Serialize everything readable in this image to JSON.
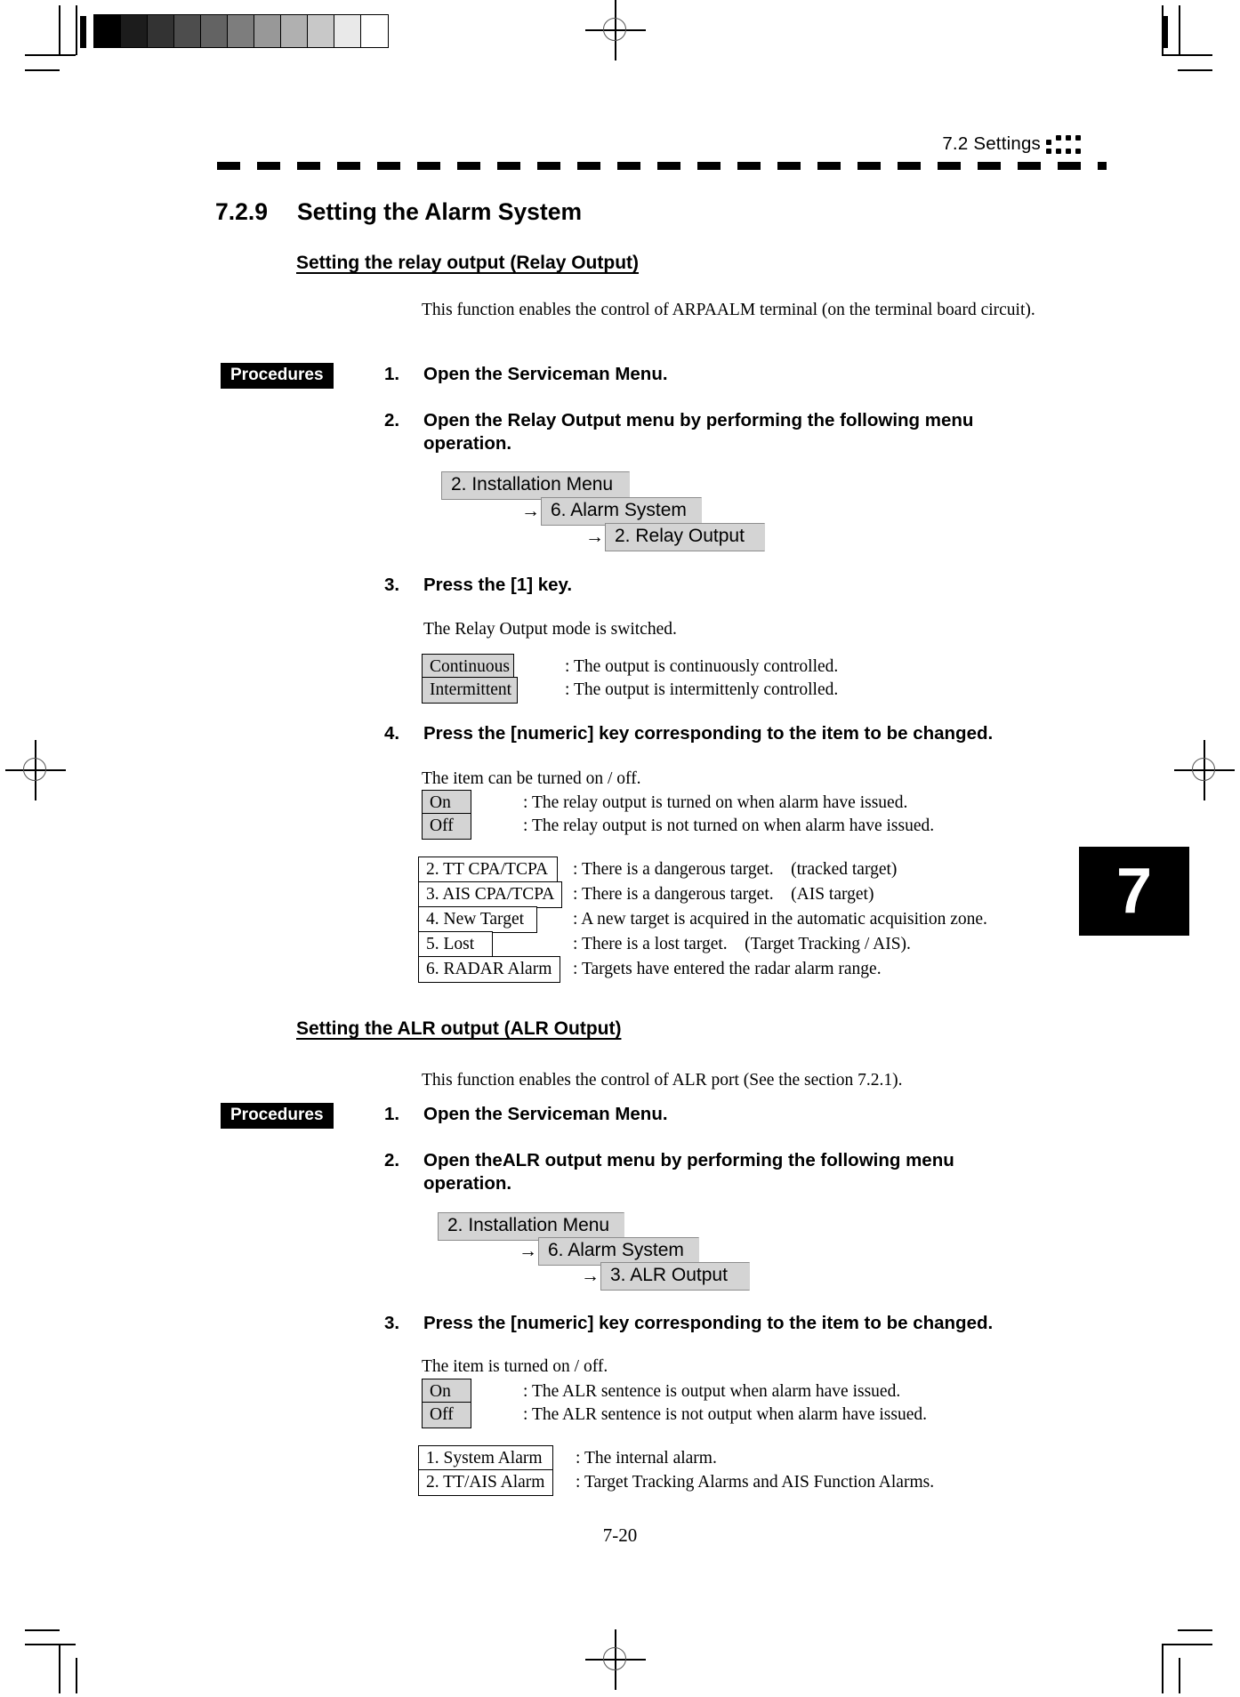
{
  "header": {
    "running_head": "7.2    Settings",
    "chapter_tab": "7",
    "page_number": "7-20"
  },
  "section": {
    "number": "7.2.9",
    "title": "Setting the Alarm System"
  },
  "relay": {
    "heading": "Setting the relay output (Relay Output)",
    "intro": "This function enables the control of ARPAALM terminal (on the terminal board circuit).",
    "procedures_badge": "Procedures",
    "steps": [
      {
        "n": "1.",
        "text": "Open the Serviceman Menu."
      },
      {
        "n": "2.",
        "text": "Open the Relay Output menu by performing the following menu operation."
      },
      {
        "n": "3.",
        "text": "Press the [1] key."
      },
      {
        "n": "4.",
        "text": "Press the [numeric] key corresponding to the item to be changed."
      }
    ],
    "menu_path": [
      {
        "arrow": "",
        "label": "2. Installation Menu"
      },
      {
        "arrow": "→",
        "label": "6. Alarm System"
      },
      {
        "arrow": "→",
        "label": "2. Relay Output"
      }
    ],
    "mode_note": "The Relay Output mode is switched.",
    "modes": [
      {
        "label": "Continuous",
        "desc": ": The output is continuously controlled."
      },
      {
        "label": "Intermittent",
        "desc": ": The output is intermittenly controlled."
      }
    ],
    "onoff_note": "The item can be turned on / off.",
    "onoff": [
      {
        "label": "On",
        "desc": ": The relay output is turned on when alarm have issued."
      },
      {
        "label": "Off",
        "desc": ": The relay output is not turned on when alarm have issued."
      }
    ],
    "items": [
      {
        "label": "2. TT CPA/TCPA",
        "desc": ": There is a dangerous target.    (tracked target)"
      },
      {
        "label": "3. AIS CPA/TCPA",
        "desc": ": There is a dangerous target.    (AIS target)"
      },
      {
        "label": "4. New Target",
        "desc": ": A new target is acquired in the automatic acquisition zone."
      },
      {
        "label": "5. Lost",
        "desc": ": There is a lost target.    (Target Tracking / AIS)."
      },
      {
        "label": "6. RADAR Alarm",
        "desc": ": Targets have entered the radar alarm range."
      }
    ]
  },
  "alr": {
    "heading": "Setting the ALR output (ALR Output)",
    "intro": "This function enables the control of ALR port (See the section 7.2.1).",
    "procedures_badge": "Procedures",
    "steps": [
      {
        "n": "1.",
        "text": "Open the Serviceman Menu."
      },
      {
        "n": "2.",
        "text": "Open theALR output menu by performing the following menu operation."
      },
      {
        "n": "3.",
        "text": "Press the [numeric] key corresponding to the item to be changed."
      }
    ],
    "menu_path": [
      {
        "arrow": "",
        "label": "2. Installation Menu"
      },
      {
        "arrow": "→",
        "label": "6. Alarm System"
      },
      {
        "arrow": "→",
        "label": "3. ALR Output"
      }
    ],
    "onoff_note": "The item is turned on / off.",
    "onoff": [
      {
        "label": "On",
        "desc": ": The ALR sentence is output when alarm have issued."
      },
      {
        "label": "Off",
        "desc": ": The ALR sentence is not output when alarm have issued."
      }
    ],
    "items": [
      {
        "label": "1. System Alarm",
        "desc": ": The internal alarm."
      },
      {
        "label": "2. TT/AIS Alarm",
        "desc": ": Target Tracking Alarms and AIS Function Alarms."
      }
    ]
  },
  "calibration": {
    "swatches": [
      "#000000",
      "#1c1c1c",
      "#333333",
      "#4d4d4d",
      "#636363",
      "#7d7d7d",
      "#989898",
      "#b0b0b0",
      "#c8c8c8",
      "#e9e9e9",
      "#ffffff"
    ]
  }
}
